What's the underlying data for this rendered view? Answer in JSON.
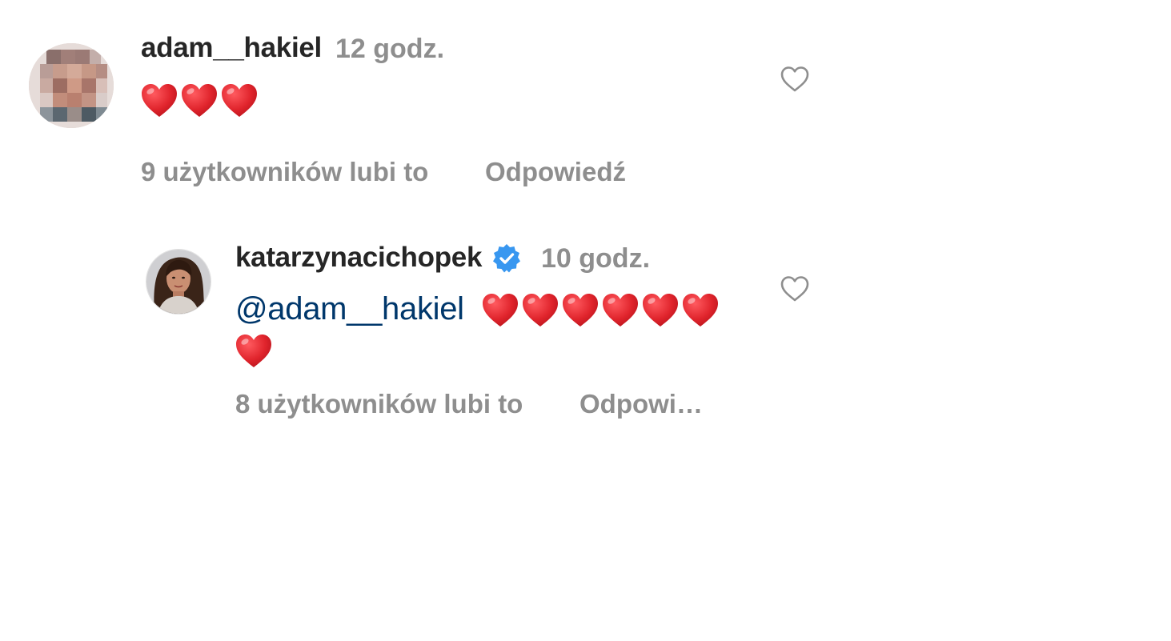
{
  "comments": [
    {
      "username": "adam__hakiel",
      "time": "12 godz.",
      "text": "",
      "heart_count": 3,
      "likes": "9 użytkowników lubi to",
      "reply": "Odpowiedź",
      "avatar": "pixelated-avatar",
      "verified": false
    },
    {
      "username": "katarzynacichopek",
      "time": "10 godz.",
      "text": "@adam__hakiel",
      "heart_count": 7,
      "likes": "8 użytkowników lubi to",
      "reply": "Odpowi…",
      "avatar": "profile-photo-avatar",
      "verified": true
    }
  ],
  "colors": {
    "username": "#262626",
    "muted": "#8e8e8e",
    "mention": "#00376b",
    "heart": "#e0242c",
    "verified": "#3897f0"
  },
  "icons": {
    "like": "heart-outline-icon",
    "verified": "verified-badge-icon",
    "emoji": "red-heart-emoji"
  }
}
